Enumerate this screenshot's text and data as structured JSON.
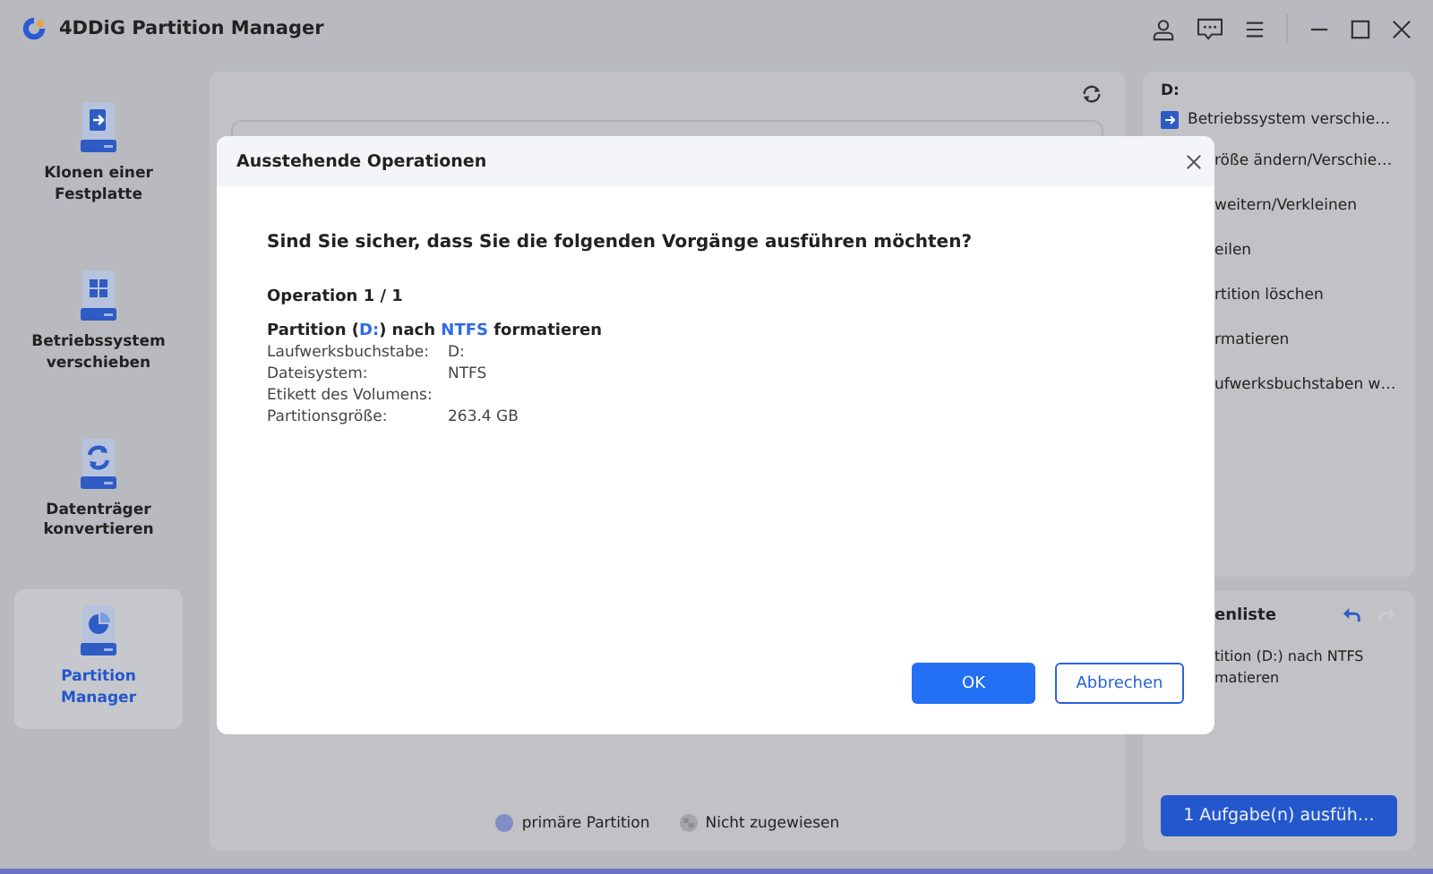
{
  "window": {
    "title": "4DDiG Partition Manager"
  },
  "sidebar": {
    "items": [
      {
        "label": "Klonen einer Festplatte",
        "kind": "clone",
        "selected": false
      },
      {
        "label": "Betriebssystem verschieben",
        "kind": "os",
        "selected": false
      },
      {
        "label": "Datenträger konvertieren",
        "kind": "convert",
        "selected": false
      },
      {
        "label": "Partition Manager",
        "kind": "partition",
        "selected": true
      }
    ]
  },
  "partition_panel": {
    "legend": [
      {
        "label": "primäre Partition",
        "kind": "primary"
      },
      {
        "label": "Nicht zugewiesen",
        "kind": "unallocated"
      }
    ]
  },
  "actions_panel": {
    "drive": "D:",
    "items": [
      {
        "label": "Betriebssystem verschie…",
        "icon": true
      },
      {
        "label": "röße ändern/Verschie…",
        "icon": false
      },
      {
        "label": "weitern/Verkleinen",
        "icon": false
      },
      {
        "label": "eilen",
        "icon": false
      },
      {
        "label": "rtition löschen",
        "icon": false
      },
      {
        "label": "rmatieren",
        "icon": false
      },
      {
        "label": "ufwerksbuchstaben w…",
        "icon": false
      }
    ]
  },
  "task_panel": {
    "title": "enliste",
    "undo_disabled": false,
    "redo_disabled": true,
    "lines": [
      "tition (D:) nach NTFS",
      "matieren"
    ],
    "run_button": "1 Aufgabe(n) ausfüh…"
  },
  "dialog": {
    "title": "Ausstehende Operationen",
    "question": "Sind Sie sicher, dass Sie die folgenden Vorgänge ausführen möchten?",
    "operation_header": "Operation 1 / 1",
    "operation_title": [
      {
        "text": "Partition (",
        "highlight": false
      },
      {
        "text": "D:",
        "highlight": true
      },
      {
        "text": ") nach ",
        "highlight": false
      },
      {
        "text": "NTFS",
        "highlight": true
      },
      {
        "text": " formatieren",
        "highlight": false
      }
    ],
    "details": [
      {
        "label": "Laufwerksbuchstabe:",
        "value": "D:"
      },
      {
        "label": "Dateisystem:",
        "value": "NTFS"
      },
      {
        "label": "Etikett des Volumens:"
      },
      {
        "label": "Partitionsgröße:",
        "value": "263.4 GB"
      }
    ],
    "buttons": [
      {
        "label": "OK",
        "kind": "primary"
      },
      {
        "label": "Abbrechen",
        "kind": "secondary"
      }
    ]
  }
}
